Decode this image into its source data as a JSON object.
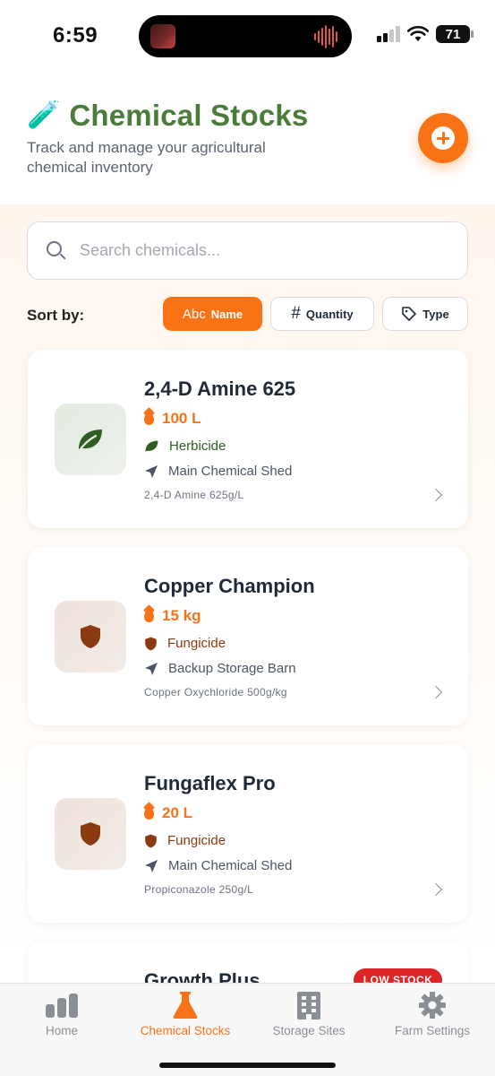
{
  "status_bar": {
    "time": "6:59",
    "battery": "71"
  },
  "header": {
    "title_icon": "🧪",
    "title": "Chemical Stocks",
    "subtitle": "Track and manage your agricultural chemical inventory",
    "add_icon": "plus-circle-icon"
  },
  "search": {
    "placeholder": "Search chemicals..."
  },
  "sort": {
    "label": "Sort by:",
    "options": [
      {
        "glyph": "Abc",
        "label": "Name",
        "active": true
      },
      {
        "glyph": "#",
        "label": "Quantity",
        "active": false
      },
      {
        "glyph": "tag",
        "label": "Type",
        "active": false
      }
    ]
  },
  "chemicals": [
    {
      "name": "2,4-D Amine 625",
      "quantity": "100 L",
      "type": "Herbicide",
      "location": "Main Chemical Shed",
      "formula": "2,4-D Amine 625g/L",
      "icon": "leaf-icon",
      "color": "#2f5d23"
    },
    {
      "name": "Copper Champion",
      "quantity": "15 kg",
      "type": "Fungicide",
      "location": "Backup Storage Barn",
      "formula": "Copper Oxychloride 500g/kg",
      "icon": "shield-icon",
      "color": "#8a3b12"
    },
    {
      "name": "Fungaflex Pro",
      "quantity": "20 L",
      "type": "Fungicide",
      "location": "Main Chemical Shed",
      "formula": "Propiconazole 250g/L",
      "icon": "shield-icon",
      "color": "#8a3b12"
    },
    {
      "name": "Growth Plus",
      "badge": "LOW STOCK"
    }
  ],
  "tabs": [
    {
      "label": "Home",
      "icon": "bar-chart-icon",
      "active": false
    },
    {
      "label": "Chemical Stocks",
      "icon": "flask-icon",
      "active": true
    },
    {
      "label": "Storage Sites",
      "icon": "building-icon",
      "active": false
    },
    {
      "label": "Farm Settings",
      "icon": "gear-icon",
      "active": false
    }
  ],
  "colors": {
    "accent": "#f97316",
    "brand_green": "#4a7c3a",
    "danger": "#dc2626"
  }
}
